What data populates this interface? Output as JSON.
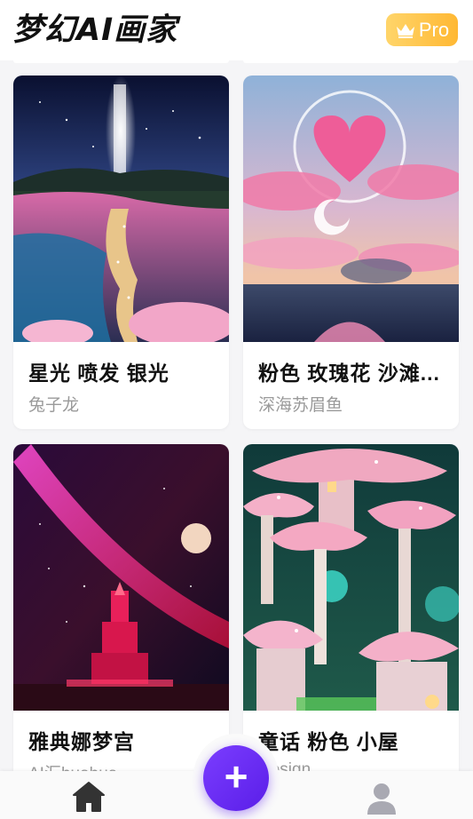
{
  "app": {
    "title": "梦幻AI画家",
    "pro_label": "Pro"
  },
  "cards": [
    {
      "title": "星光 喷发  银光",
      "author": "兔子龙",
      "image": "starlight-river"
    },
    {
      "title": "粉色 玫瑰花 沙滩...",
      "author": "深海苏眉鱼",
      "image": "pink-heart-clouds"
    },
    {
      "title": "雅典娜梦宫",
      "author": "AI汇huahua",
      "image": "red-palace-moon"
    },
    {
      "title": "童话  粉色  小屋",
      "author": "Design",
      "image": "mushroom-houses"
    }
  ],
  "bottom_nav": {
    "home_icon": "home-icon",
    "add_icon": "plus-icon",
    "add_label": "+",
    "profile_icon": "user-icon"
  },
  "colors": {
    "accent": "#6a2cf2",
    "pro_badge": "#ffc54d"
  }
}
